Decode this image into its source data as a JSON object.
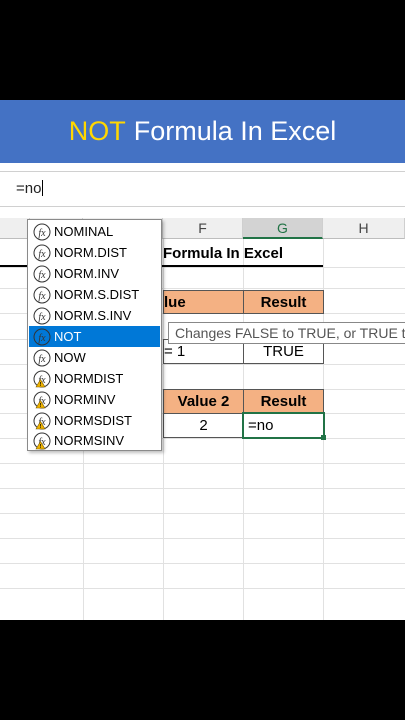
{
  "banner": {
    "accent": "NOT",
    "rest": "Formula In Excel"
  },
  "formula_bar": {
    "value": "=no"
  },
  "columns": [
    {
      "label": "F",
      "selected": false
    },
    {
      "label": "G",
      "selected": true
    },
    {
      "label": "H",
      "selected": false
    }
  ],
  "sheet": {
    "title_fragment": "Formula In Excel",
    "table1": {
      "header_value": "lue",
      "header_result": "Result",
      "row_value": "= 1",
      "row_result": "TRUE"
    },
    "table2": {
      "header_value": "Value 2",
      "header_result": "Result",
      "row_value": "2",
      "row_result": "=no"
    }
  },
  "tooltip": "Changes FALSE to TRUE, or TRUE to",
  "autocomplete": {
    "items": [
      {
        "label": "NOMINAL",
        "icon": "function-icon"
      },
      {
        "label": "NORM.DIST",
        "icon": "function-icon"
      },
      {
        "label": "NORM.INV",
        "icon": "function-icon"
      },
      {
        "label": "NORM.S.DIST",
        "icon": "function-icon"
      },
      {
        "label": "NORM.S.INV",
        "icon": "function-icon"
      },
      {
        "label": "NOT",
        "icon": "function-icon",
        "selected": true
      },
      {
        "label": "NOW",
        "icon": "function-icon"
      },
      {
        "label": "NORMDIST",
        "icon": "compat-function-icon"
      },
      {
        "label": "NORMINV",
        "icon": "compat-function-icon"
      },
      {
        "label": "NORMSDIST",
        "icon": "compat-function-icon"
      },
      {
        "label": "NORMSINV",
        "icon": "compat-function-icon"
      }
    ]
  },
  "colors": {
    "banner": "#4472c4",
    "accent": "#ffd700",
    "header_fill": "#f4b183",
    "selection": "#0078d7",
    "active_cell": "#217346"
  }
}
